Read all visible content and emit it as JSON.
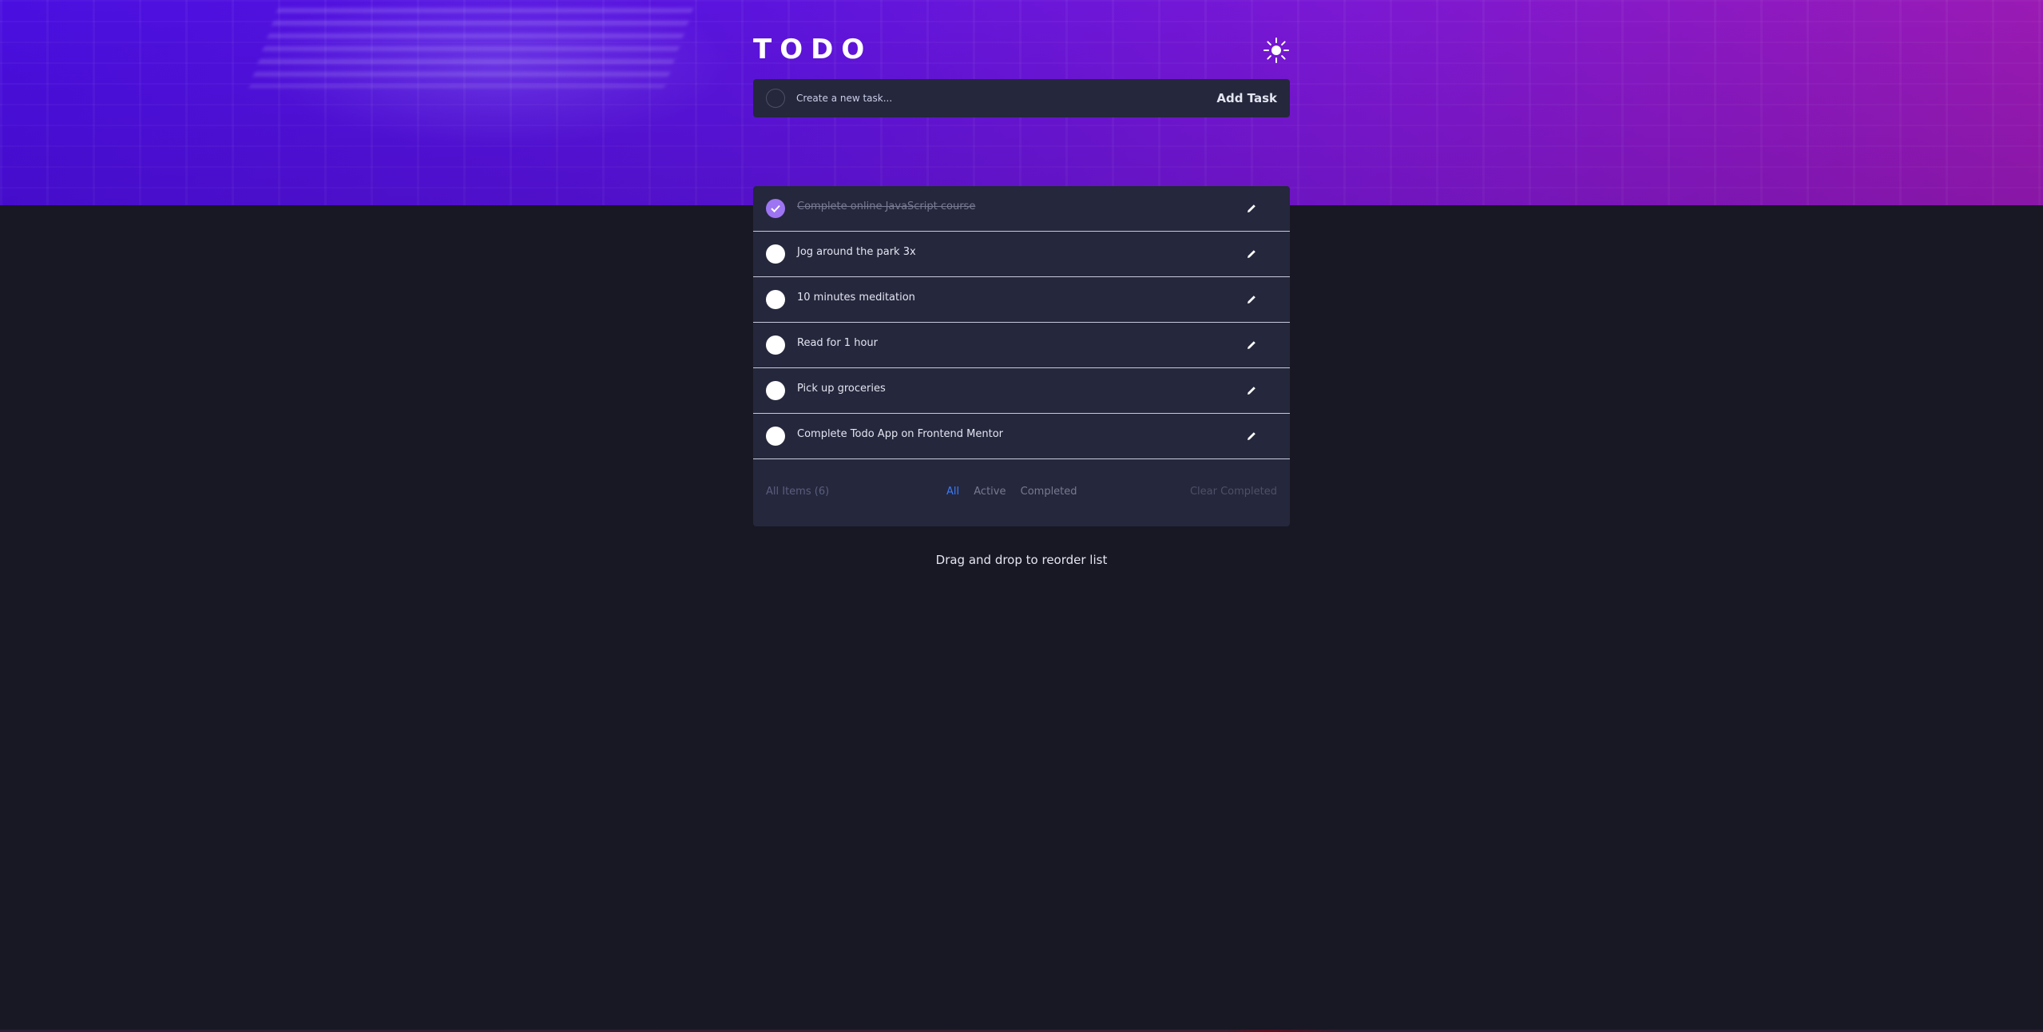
{
  "app": {
    "title": "TODO",
    "theme_icon": "sun-icon"
  },
  "new_task": {
    "placeholder": "Create a new task...",
    "add_label": "Add Task"
  },
  "tasks": [
    {
      "text": "Complete online JavaScript course",
      "completed": true
    },
    {
      "text": "Jog around the park 3x",
      "completed": false
    },
    {
      "text": "10 minutes meditation",
      "completed": false
    },
    {
      "text": "Read for 1 hour",
      "completed": false
    },
    {
      "text": "Pick up groceries",
      "completed": false
    },
    {
      "text": "Complete Todo App on Frontend Mentor",
      "completed": false
    }
  ],
  "footer": {
    "count_label": "All Items (6)",
    "filters": [
      {
        "label": "All",
        "active": true
      },
      {
        "label": "Active",
        "active": false
      },
      {
        "label": "Completed",
        "active": false
      }
    ],
    "clear_label": "Clear Completed"
  },
  "hint": "Drag and drop to reorder list",
  "colors": {
    "background": "#181824",
    "card": "#25273c",
    "accent": "#3a7cfd",
    "check": "#9d74f2"
  }
}
